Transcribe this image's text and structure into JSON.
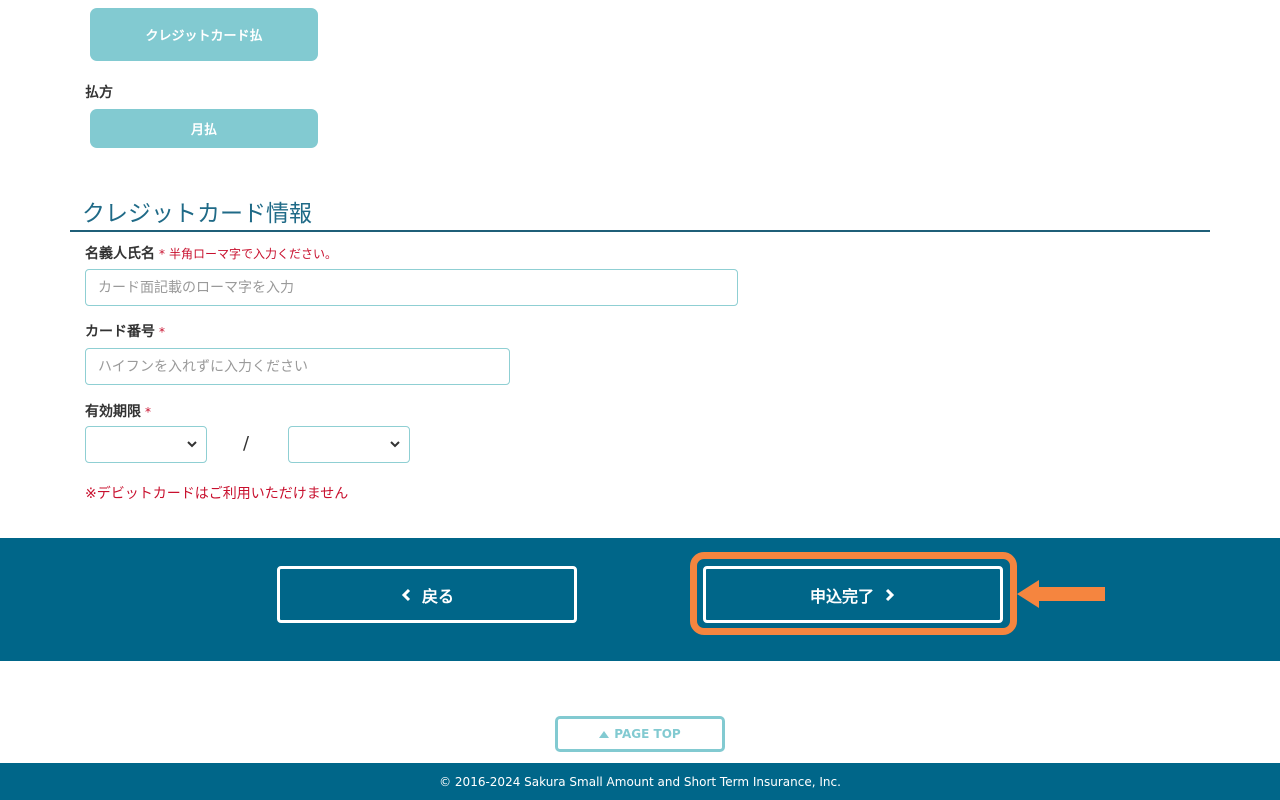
{
  "payment": {
    "method_button": "クレジットカード払",
    "frequency_label": "払方",
    "frequency_button": "月払"
  },
  "credit_card": {
    "section_title": "クレジットカード情報",
    "name": {
      "label": "名義人氏名",
      "required_mark": "*",
      "note": "半角ローマ字で入力ください。",
      "value": "",
      "placeholder": "カード面記載のローマ字を入力"
    },
    "number": {
      "label": "カード番号",
      "required_mark": "*",
      "value": "",
      "placeholder": "ハイフンを入れずに入力ください"
    },
    "expiry": {
      "label": "有効期限",
      "required_mark": "*",
      "month_value": "",
      "year_value": "",
      "separator": "/"
    },
    "debit_warning": "※デビットカードはご利用いただけません"
  },
  "actions": {
    "back_label": "戻る",
    "submit_label": "申込完了"
  },
  "annotation": {
    "highlight_color": "#f5853f"
  },
  "page_top_label": "PAGE TOP",
  "footer": {
    "copyright": "© 2016-2024 Sakura Small Amount and Short Term Insurance, Inc."
  },
  "colors": {
    "brand": "#006689",
    "accent": "#82cad1",
    "error": "#c8102e"
  }
}
